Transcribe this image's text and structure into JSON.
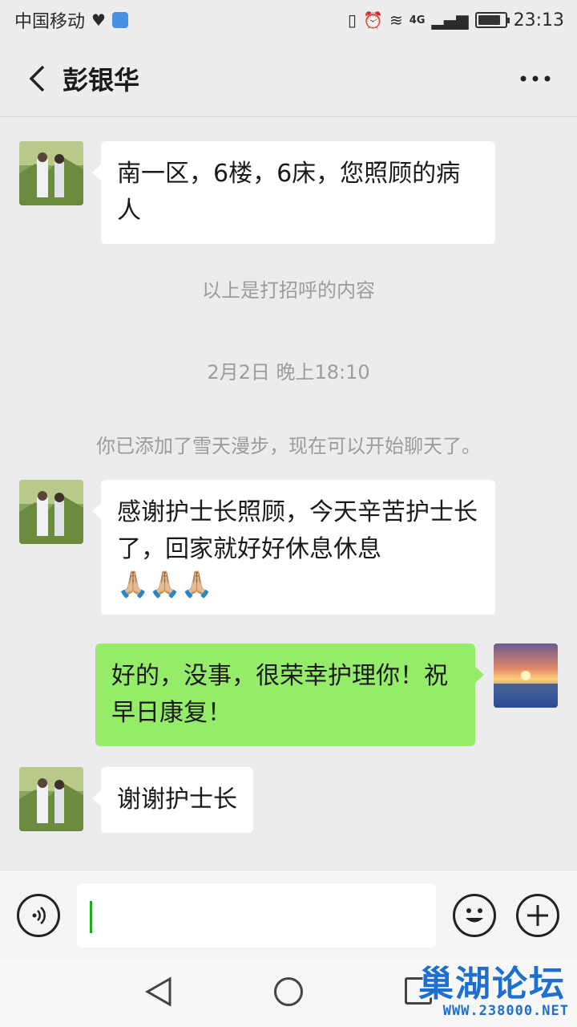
{
  "status_bar": {
    "carrier": "中国移动",
    "network": "4G",
    "time": "23:13",
    "battery_level": 0.85
  },
  "header": {
    "title": "彭银华"
  },
  "messages": [
    {
      "text": "南一区，6楼，6床，您照顾的病人"
    },
    {
      "system": "以上是打招呼的内容"
    },
    {
      "timestamp": "2月2日 晚上18:10"
    },
    {
      "system2": "你已添加了雪天漫步，现在可以开始聊天了。"
    },
    {
      "text": "感谢护士长照顾，今天辛苦护士长了，回家就好好休息休息",
      "emoji": "🙏🏼🙏🏼🙏🏼"
    },
    {
      "text": "好的，没事，很荣幸护理你！祝早日康复！"
    },
    {
      "text": "谢谢护士长"
    }
  ],
  "input": {
    "value": ""
  },
  "watermark": {
    "title": "巢湖论坛",
    "url": "WWW.238000.NET"
  },
  "colors": {
    "accent_green": "#95ec69",
    "background": "#ececec"
  },
  "icons": [
    "back-arrow-icon",
    "more-icon",
    "voice-icon",
    "emoji-icon",
    "plus-icon",
    "nav-back-icon",
    "nav-home-icon",
    "nav-recent-icon"
  ]
}
